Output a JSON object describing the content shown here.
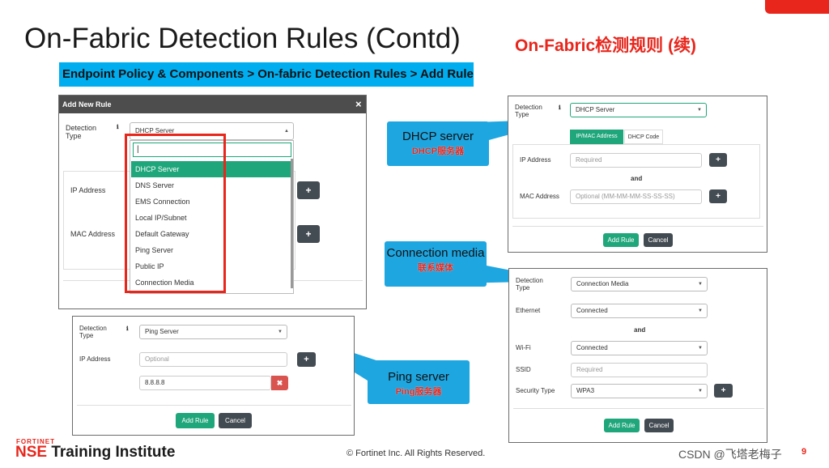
{
  "slide": {
    "title": "On-Fabric Detection Rules (Contd)",
    "title_cn": "On-Fabric检测规则 (续)",
    "breadcrumb": "Endpoint Policy & Components > On-fabric Detection Rules > Add Rule",
    "accent_color": "#e8261c",
    "breadcrumb_color": "#00aeef"
  },
  "add_rule_dialog": {
    "header_title": "Add New Rule",
    "close_label": "×",
    "detection_type_label": "Detection Type",
    "selected_value": "DHCP Server",
    "ip_address_label": "IP Address",
    "mac_address_label": "MAC Address",
    "search_value": "",
    "dropdown_options": [
      "DHCP Server",
      "DNS Server",
      "EMS Connection",
      "Local IP/Subnet",
      "Default Gateway",
      "Ping Server",
      "Public IP",
      "Connection Media"
    ]
  },
  "dhcp_panel": {
    "detection_type_label": "Detection Type",
    "selected_value": "DHCP Server",
    "tab_ipmac": "IP/MAC Address",
    "tab_dhcp_code": "DHCP Code",
    "ip_address_label": "IP Address",
    "ip_placeholder": "Required",
    "and_label": "and",
    "mac_address_label": "MAC Address",
    "mac_placeholder": "Optional (MM-MM-MM-SS-SS-SS)",
    "add_rule_label": "Add Rule",
    "cancel_label": "Cancel"
  },
  "connection_panel": {
    "detection_type_label": "Detection Type",
    "selected_value": "Connection Media",
    "ethernet_label": "Ethernet",
    "ethernet_value": "Connected",
    "and_label": "and",
    "wifi_label": "Wi-Fi",
    "wifi_value": "Connected",
    "ssid_label": "SSID",
    "ssid_placeholder": "Required",
    "security_type_label": "Security Type",
    "security_type_value": "WPA3",
    "add_rule_label": "Add Rule",
    "cancel_label": "Cancel"
  },
  "ping_panel": {
    "detection_type_label": "Detection Type",
    "selected_value": "Ping Server",
    "ip_address_label": "IP Address",
    "ip_placeholder": "Optional",
    "ip_entry": "8.8.8.8",
    "add_rule_label": "Add Rule",
    "cancel_label": "Cancel"
  },
  "callouts": {
    "dhcp_en": "DHCP server",
    "dhcp_cn": "DHCP服务器",
    "conn_en": "Connection media",
    "conn_cn": "联系媒体",
    "ping_en": "Ping server",
    "ping_cn": "Ping服务器"
  },
  "footer": {
    "fortinet": "FORTINET",
    "nse": "NSE",
    "training_institute": "Training Institute",
    "copyright": "© Fortinet Inc. All Rights Reserved.",
    "watermark": "CSDN @飞塔老梅子",
    "page_number": "9"
  }
}
